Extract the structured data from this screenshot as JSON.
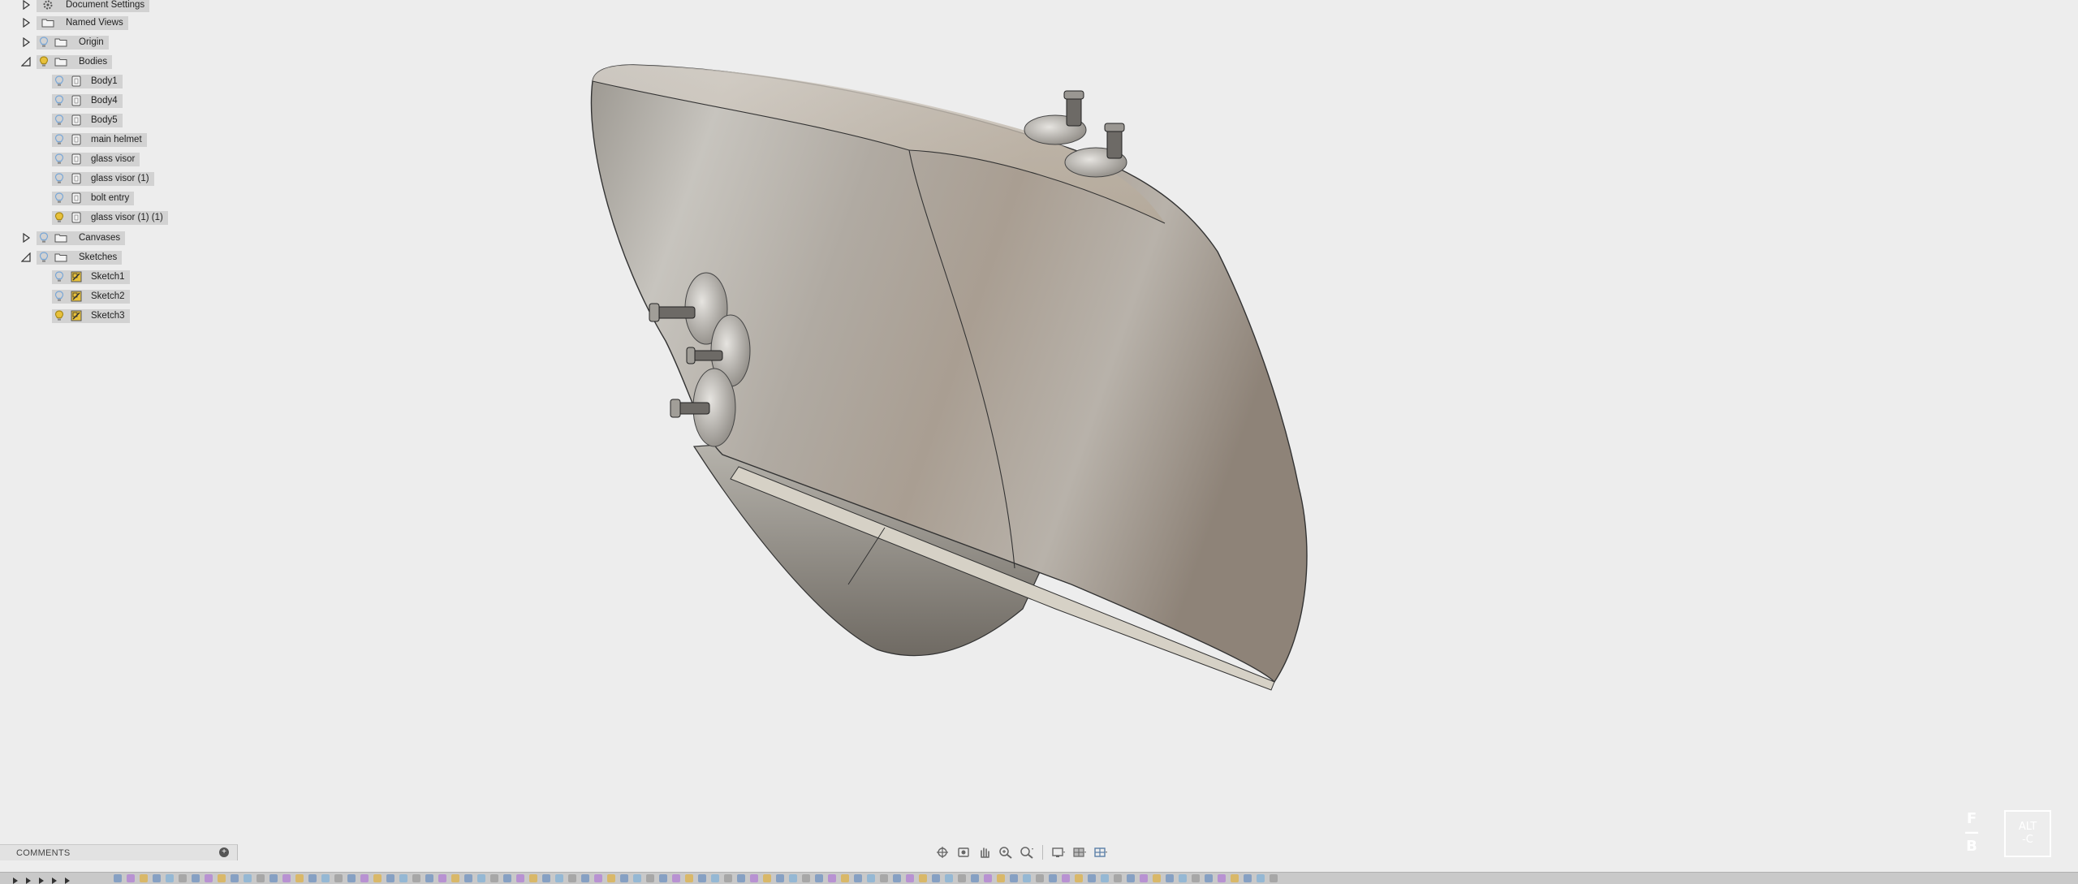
{
  "browser": {
    "items": [
      {
        "label": "Document Settings",
        "icon": "gear-icon",
        "expanded": false
      },
      {
        "label": "Named Views",
        "icon": "folder-icon",
        "expanded": false
      },
      {
        "label": "Origin",
        "icon": "folder-icon",
        "expanded": false
      },
      {
        "label": "Bodies",
        "icon": "folder-icon",
        "expanded": true
      },
      {
        "label": "Body1",
        "icon": "body-icon"
      },
      {
        "label": "Body4",
        "icon": "body-icon"
      },
      {
        "label": "Body5",
        "icon": "body-icon"
      },
      {
        "label": "main helmet",
        "icon": "body-icon"
      },
      {
        "label": "glass visor",
        "icon": "body-icon"
      },
      {
        "label": "glass visor (1)",
        "icon": "body-icon"
      },
      {
        "label": "bolt entry",
        "icon": "body-icon"
      },
      {
        "label": "glass visor (1) (1)",
        "icon": "body-icon"
      },
      {
        "label": "Canvases",
        "icon": "folder-icon",
        "expanded": false
      },
      {
        "label": "Sketches",
        "icon": "folder-icon",
        "expanded": true
      },
      {
        "label": "Sketch1",
        "icon": "sketch-icon"
      },
      {
        "label": "Sketch2",
        "icon": "sketch-icon"
      },
      {
        "label": "Sketch3",
        "icon": "sketch-icon"
      }
    ]
  },
  "comments": {
    "label": "COMMENTS"
  },
  "navbar": {
    "icons": [
      "orbit-icon",
      "look-at-icon",
      "pan-icon",
      "zoom-icon",
      "zoom-window-icon",
      "display-settings-icon",
      "grid-settings-icon",
      "viewports-icon"
    ]
  },
  "watermark": {
    "ff": "F—B",
    "altc": "ALT\n-C"
  },
  "colors": {
    "background": "#ededed",
    "highlight": "#d2d2d2",
    "bulb_on": "#e8c13a",
    "bulb_off": "#7aa7d6",
    "model": "#a8a096"
  }
}
